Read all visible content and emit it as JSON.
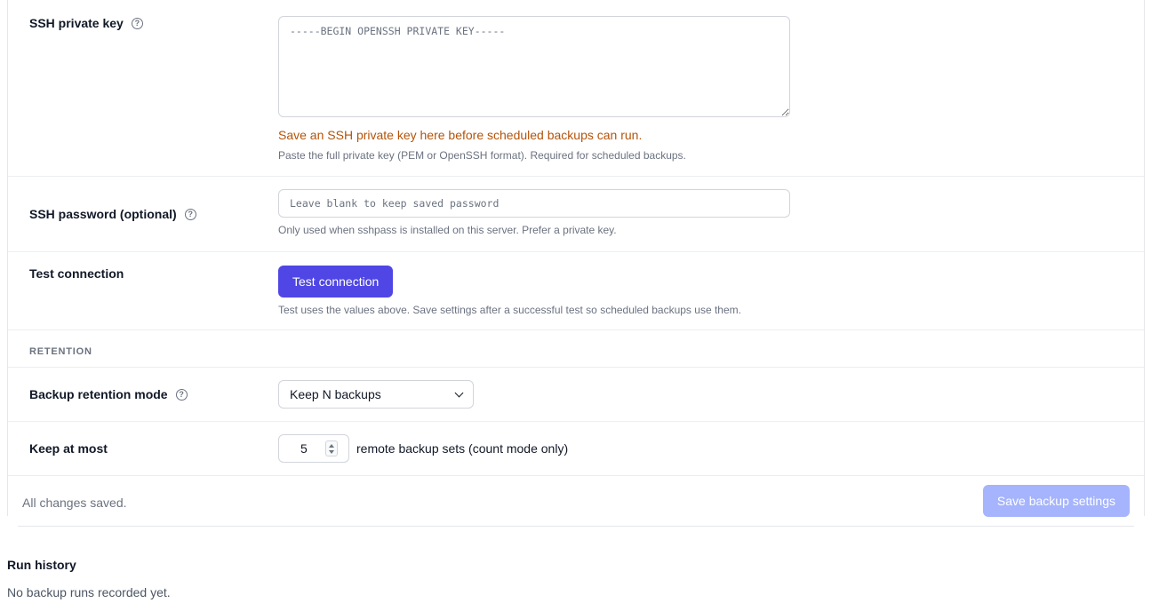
{
  "ssh_key": {
    "label": "SSH private key",
    "placeholder": "-----BEGIN OPENSSH PRIVATE KEY-----",
    "warning": "Save an SSH private key here before scheduled backups can run.",
    "hint": "Paste the full private key (PEM or OpenSSH format). Required for scheduled backups."
  },
  "ssh_password": {
    "label": "SSH password (optional)",
    "placeholder": "Leave blank to keep saved password",
    "hint": "Only used when sshpass is installed on this server. Prefer a private key."
  },
  "test_connection": {
    "label": "Test connection",
    "button_label": "Test connection",
    "hint": "Test uses the values above. Save settings after a successful test so scheduled backups use them."
  },
  "retention": {
    "heading": "RETENTION",
    "mode_label": "Backup retention mode",
    "mode_value": "Keep N backups",
    "keep_label": "Keep at most",
    "keep_value": "5",
    "keep_suffix": "remote backup sets (count mode only)"
  },
  "footer": {
    "status": "All changes saved.",
    "save_label": "Save backup settings"
  },
  "run_history": {
    "title": "Run history",
    "empty": "No backup runs recorded yet."
  },
  "help_glyph": "?",
  "colors": {
    "primary": "#4f46e5",
    "primary_disabled": "#a5b4fc",
    "warning": "#b45309"
  }
}
